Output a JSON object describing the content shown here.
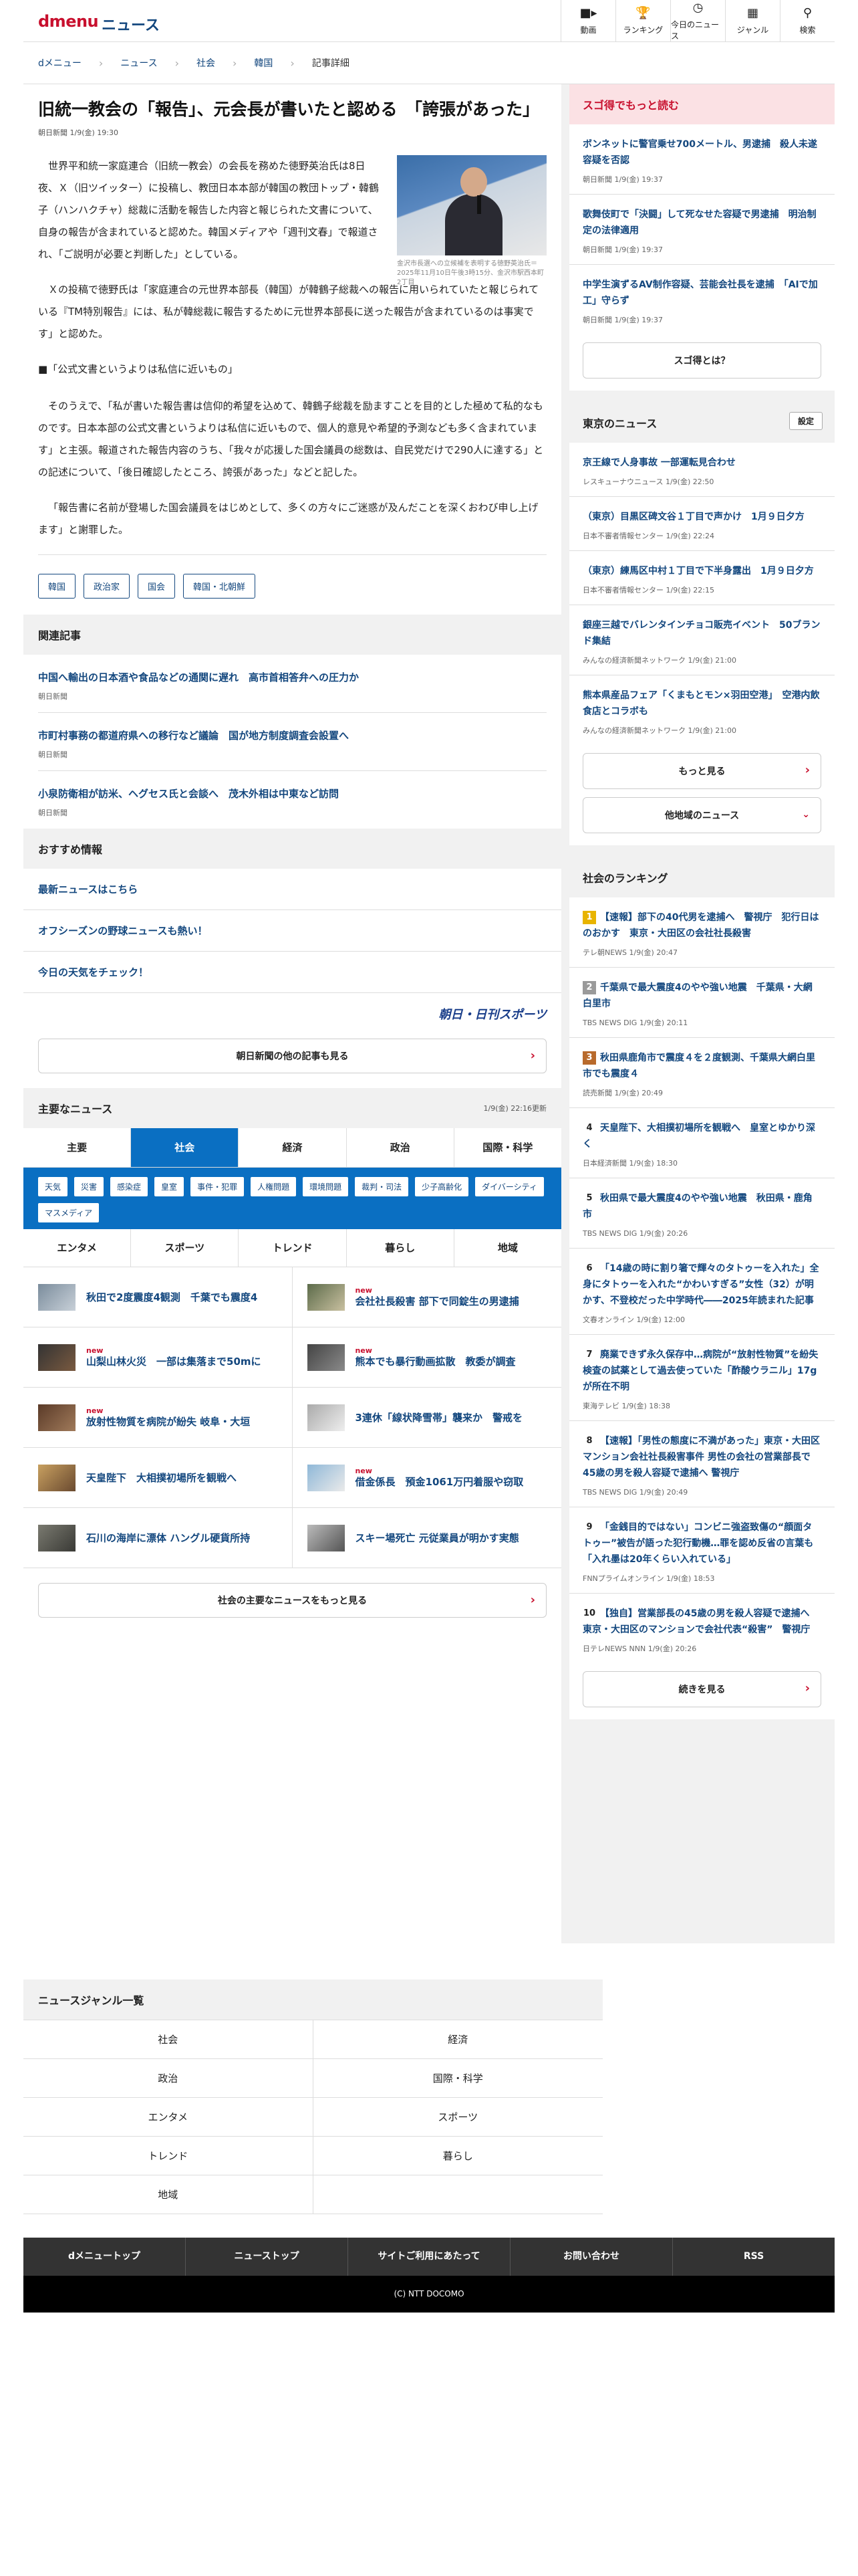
{
  "header": {
    "logo": "dmenu",
    "logo_news": "ニュース",
    "nav": [
      {
        "label": "動画",
        "icon": "video-icon"
      },
      {
        "label": "ランキング",
        "icon": "trophy-icon"
      },
      {
        "label": "今日のニュース",
        "icon": "clock-icon"
      },
      {
        "label": "ジャンル",
        "icon": "grid-icon"
      },
      {
        "label": "検索",
        "icon": "search-icon"
      }
    ]
  },
  "breadcrumb": [
    "dメニュー",
    "ニュース",
    "社会",
    "韓国",
    "記事詳細"
  ],
  "article": {
    "title": "旧統一教会の「報告」、元会長が書いたと認める　「誇張があった」",
    "source_time": "朝日新聞 1/9(金) 19:30",
    "photo_caption": "金沢市長選への立候補を表明する徳野英治氏＝2025年11月10日午後3時15分、金沢市駅西本町2丁目",
    "p1": "世界平和統一家庭連合（旧統一教会）の会長を務めた徳野英治氏は8日夜、Ｘ（旧ツイッター）に投稿し、教団日本本部が韓国の教団トップ・韓鶴子（ハンハクチャ）総裁に活動を報告した内容と報じられた文書について、自身の報告が含まれていると認めた。韓国メディアや「週刊文春」で報道され、「ご説明が必要と判断した」としている。",
    "p2": "Ｘの投稿で徳野氏は「家庭連合の元世界本部長（韓国）が韓鶴子総裁への報告に用いられていたと報じられている『TM特別報告』には、私が韓総裁に報告するために元世界本部長に送った報告が含まれているのは事実です」と認めた。",
    "subhead": "■「公式文書というよりは私信に近いもの」",
    "p3": "そのうえで、「私が書いた報告書は信仰的希望を込めて、韓鶴子総裁を励ますことを目的とした極めて私的なものです。日本本部の公式文書というよりは私信に近いもので、個人的意見や希望的予測なども多く含まれています」と主張。報道された報告内容のうち、「我々が応援した国会議員の総数は、自民党だけで290人に達する」との記述について、「後日確認したところ、誇張があった」などと記した。",
    "p4": "「報告書に名前が登場した国会議員をはじめとして、多くの方々にご迷惑が及んだことを深くおわび申し上げます」と謝罪した。",
    "tags": [
      "韓国",
      "政治家",
      "国会",
      "韓国・北朝鮮"
    ]
  },
  "related": {
    "heading": "関連記事",
    "items": [
      {
        "title": "中国へ輸出の日本酒や食品などの通関に遅れ　高市首相答弁への圧力か",
        "source": "朝日新聞"
      },
      {
        "title": "市町村事務の都道府県への移行など議論　国が地方制度調査会設置へ",
        "source": "朝日新聞"
      },
      {
        "title": "小泉防衛相が訪米、ヘグセス氏と会談へ　茂木外相は中東など訪問",
        "source": "朝日新聞"
      }
    ]
  },
  "recommend": {
    "heading": "おすすめ情報",
    "items": [
      "最新ニュースはこちら",
      "オフシーズンの野球ニュースも熱い！",
      "今日の天気をチェック！"
    ],
    "brand": "朝日・日刊スポーツ",
    "more": "朝日新聞の他の記事も見る"
  },
  "major": {
    "heading": "主要なニュース",
    "updated": "1/9(金) 22:16更新",
    "tabs": [
      "主要",
      "社会",
      "経済",
      "政治",
      "国際・科学"
    ],
    "chips": [
      "天気",
      "災害",
      "感染症",
      "皇室",
      "事件・犯罪",
      "人権問題",
      "環境問題",
      "裁判・司法",
      "少子高齢化",
      "ダイバーシティ",
      "マスメディア"
    ],
    "tabs2": [
      "エンタメ",
      "スポーツ",
      "トレンド",
      "暮らし",
      "地域"
    ],
    "items": [
      {
        "title": "秋田で2度震度4観測　千葉でも震度4",
        "new": ""
      },
      {
        "title": "会社社長殺害 部下で同錠生の男逮捕",
        "new": "new"
      },
      {
        "title": "山梨山林火災　一部は集落まで50mに",
        "new": "new"
      },
      {
        "title": "熊本でも暴行動画拡散　教委が調査",
        "new": "new"
      },
      {
        "title": "放射性物質を病院が紛失 岐阜・大垣",
        "new": "new"
      },
      {
        "title": "3連休「線状降雪帯」襲来か　警戒を",
        "new": ""
      },
      {
        "title": "天皇陛下　大相撲初場所を観戦へ",
        "new": ""
      },
      {
        "title": "借金係長　預金1061万円着服や窃取",
        "new": "new"
      },
      {
        "title": "石川の海岸に漂体 ハングル硬貨所持",
        "new": ""
      },
      {
        "title": "スキー場死亡 元従業員が明かす実態",
        "new": ""
      }
    ],
    "more": "社会の主要なニュースをもっと見る"
  },
  "genre": {
    "heading": "ニュースジャンル一覧",
    "items": [
      "社会",
      "経済",
      "政治",
      "国際・科学",
      "エンタメ",
      "スポーツ",
      "トレンド",
      "暮らし",
      "地域",
      ""
    ]
  },
  "footer": {
    "nav": [
      "dメニュートップ",
      "ニューストップ",
      "サイトご利用にあたって",
      "お問い合わせ",
      "RSS"
    ],
    "copyright": "(C) NTT DOCOMO"
  },
  "sidebar": {
    "sugotoku": {
      "heading": "スゴ得でもっと読む",
      "items": [
        {
          "title": "ボンネットに警官乗せ700メートル、男逮捕　殺人未遂容疑を否認",
          "source": "朝日新聞 1/9(金) 19:37"
        },
        {
          "title": "歌舞伎町で「決闘」して死なせた容疑で男逮捕　明治制定の法律適用",
          "source": "朝日新聞 1/9(金) 19:37"
        },
        {
          "title": "中学生演ずるAV制作容疑、芸能会社長を逮捕　「AIで加工」守らず",
          "source": "朝日新聞 1/9(金) 19:37"
        }
      ],
      "button": "スゴ得とは？"
    },
    "tokyo": {
      "heading": "東京のニュース",
      "setting": "設定",
      "items": [
        {
          "title": "京王線で人身事故 一部運転見合わせ",
          "source": "レスキューナウニュース 1/9(金) 22:50"
        },
        {
          "title": "（東京）目黒区碑文谷１丁目で声かけ　1月９日夕方",
          "source": "日本不審者情報センター 1/9(金) 22:24"
        },
        {
          "title": "（東京）練馬区中村１丁目で下半身露出　1月９日夕方",
          "source": "日本不審者情報センター 1/9(金) 22:15"
        },
        {
          "title": "銀座三越でバレンタインチョコ販売イベント　50ブランド集結",
          "source": "みんなの経済新聞ネットワーク 1/9(金) 21:00"
        },
        {
          "title": "熊本県産品フェア「くまもとモン×羽田空港」　空港内飲食店とコラボも",
          "source": "みんなの経済新聞ネットワーク 1/9(金) 21:00"
        }
      ],
      "more": "もっと見る",
      "other": "他地域のニュース"
    },
    "ranking": {
      "heading": "社会のランキング",
      "items": [
        {
          "rank": "1",
          "color": "#e8b400",
          "title": "【速報】部下の40代男を逮捕へ　警視庁　犯行日はのおかす　東京・大田区の会社社長殺害",
          "source": "テレ朝NEWS 1/9(金) 20:47"
        },
        {
          "rank": "2",
          "color": "#9a9a9a",
          "title": "千葉県で最大震度4のやや強い地震　千葉県・大網白里市",
          "source": "TBS NEWS DIG 1/9(金) 20:11"
        },
        {
          "rank": "3",
          "color": "#b86a2c",
          "title": "秋田県鹿角市で震度４を２度観測、千葉県大網白里市でも震度４",
          "source": "読売新聞 1/9(金) 20:49"
        },
        {
          "rank": "4",
          "color": "",
          "title": "天皇陛下、大相撲初場所を観戦へ　皇室とゆかり深く",
          "source": "日本経済新聞 1/9(金) 18:30"
        },
        {
          "rank": "5",
          "color": "",
          "title": "秋田県で最大震度4のやや強い地震　秋田県・鹿角市",
          "source": "TBS NEWS DIG 1/9(金) 20:26"
        },
        {
          "rank": "6",
          "color": "",
          "title": "「14歳の時に割り箸で輝々のタトゥーを入れた」全身にタトゥーを入れた“かわいすぎる”女性（32）が明かす、不登校だった中学時代――2025年読まれた記事",
          "source": "文春オンライン 1/9(金) 12:00"
        },
        {
          "rank": "7",
          "color": "",
          "title": "廃業できず永久保存中…病院が“放射性物質”を紛失　検査の試薬として過去使っていた「酢酸ウラニル」17gが所在不明",
          "source": "東海テレビ 1/9(金) 18:38"
        },
        {
          "rank": "8",
          "color": "",
          "title": "【速報】「男性の態度に不満があった」東京・大田区マンション会社社長殺害事件 男性の会社の営業部長で45歳の男を殺人容疑で逮捕へ 警視庁",
          "source": "TBS NEWS DIG 1/9(金) 20:49"
        },
        {
          "rank": "9",
          "color": "",
          "title": "「金銭目的ではない」コンビニ強盗致傷の“顔面タトゥー”被告が語った犯行動機…罪を認め反省の言葉も「入れ墨は20年くらい入れている」",
          "source": "FNNプライムオンライン 1/9(金) 18:53"
        },
        {
          "rank": "10",
          "color": "",
          "title": "【独自】営業部長の45歳の男を殺人容疑で逮捕へ　東京・大田区のマンションで会社代表“殺害”　警視庁",
          "source": "日テレNEWS NNN 1/9(金) 20:26"
        }
      ],
      "more": "続きを見る"
    }
  }
}
